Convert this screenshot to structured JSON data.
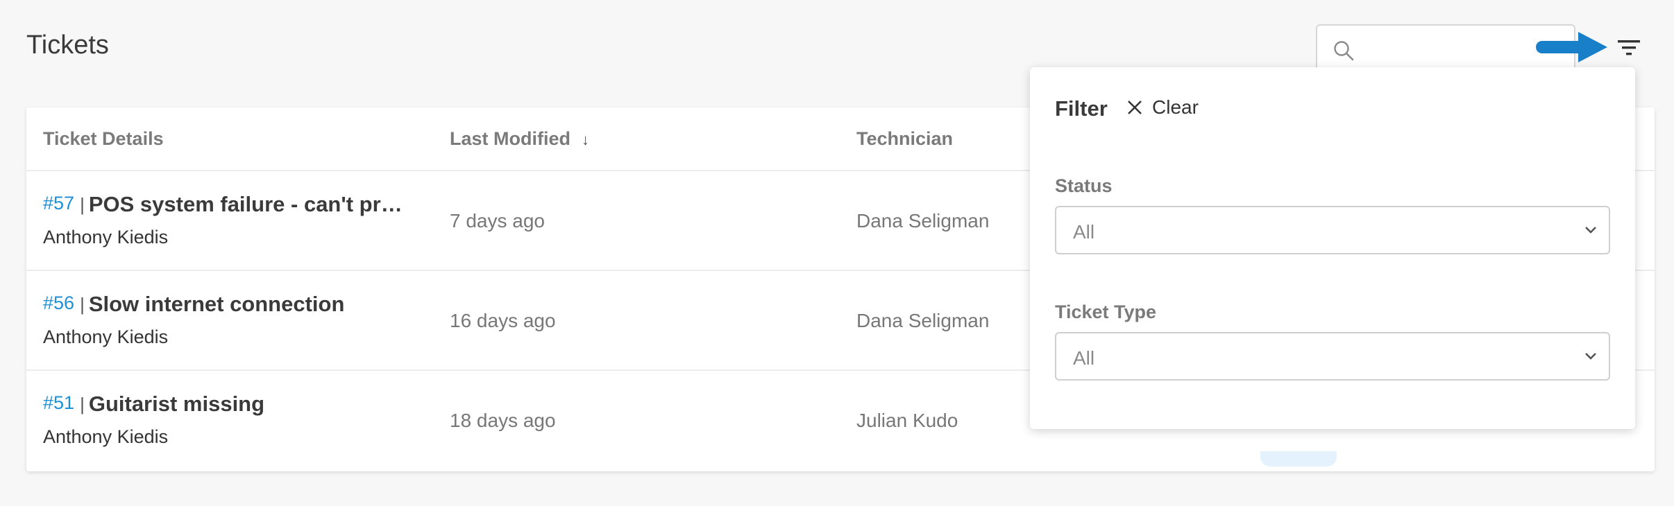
{
  "header": {
    "title": "Tickets",
    "search_placeholder": ""
  },
  "table": {
    "columns": {
      "details": "Ticket Details",
      "modified": "Last Modified",
      "modified_sort": "↓",
      "technician": "Technician"
    },
    "rows": [
      {
        "number": "#57",
        "title": "POS system failure - can't process payments",
        "requester": "Anthony Kiedis",
        "modified": "7 days ago",
        "technician": "Dana Seligman"
      },
      {
        "number": "#56",
        "title": "Slow internet connection",
        "requester": "Anthony Kiedis",
        "modified": "16 days ago",
        "technician": "Dana Seligman"
      },
      {
        "number": "#51",
        "title": "Guitarist missing",
        "requester": "Anthony Kiedis",
        "modified": "18 days ago",
        "technician": "Julian Kudo"
      }
    ]
  },
  "filter": {
    "title": "Filter",
    "clear_label": "Clear",
    "status_label": "Status",
    "status_value": "All",
    "type_label": "Ticket Type",
    "type_value": "All"
  },
  "colors": {
    "accent": "#1f8fd6",
    "annotation_arrow": "#1a7fc9"
  },
  "icons": {
    "search": "search-icon",
    "filter": "filter-icon",
    "clear": "close-icon",
    "dropdown": "chevron-down-icon"
  }
}
